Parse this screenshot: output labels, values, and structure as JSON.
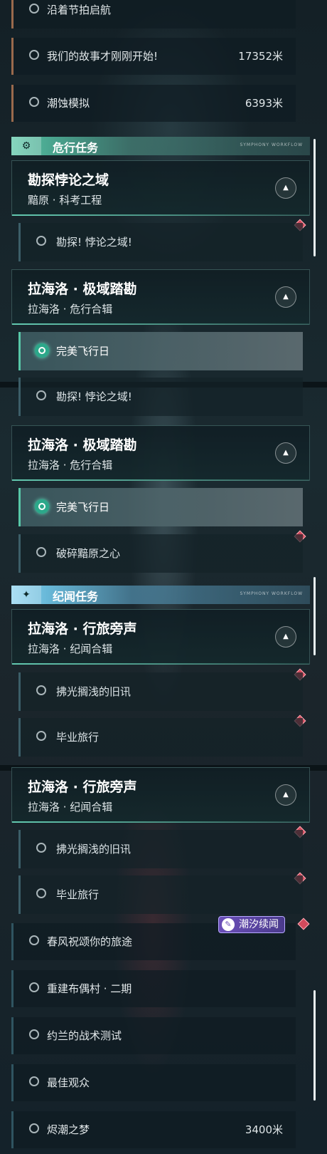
{
  "top_list": [
    {
      "label": "沿着节拍启航",
      "distance": ""
    },
    {
      "label": "我们的故事才刚刚开始!",
      "distance": "17352米"
    },
    {
      "label": "潮蚀模拟",
      "distance": "6393米"
    }
  ],
  "section_danger": {
    "title": "危行任务",
    "tag": "SYMPHONY WORKFLOW",
    "icon": "gear-icon",
    "accent": "#5dc8a8",
    "cards": [
      {
        "title": "勘探悖论之域",
        "subtitle": "黯原 · 科考工程"
      },
      {
        "title": "拉海洛 · 极域踏勘",
        "subtitle": "拉海洛 · 危行合辑"
      }
    ],
    "sub_items": [
      "勘探! 悖论之域!",
      "完美飞行日"
    ]
  },
  "panel2": {
    "sub_top": "勘探! 悖论之域!",
    "card": {
      "title": "拉海洛 · 极域踏勘",
      "subtitle": "拉海洛 · 危行合辑"
    },
    "sub_items": [
      "完美飞行日",
      "破碎黯原之心"
    ]
  },
  "section_story": {
    "title": "纪闻任务",
    "tag": "SYMPHONY WORKFLOW",
    "icon": "sparkle-icon",
    "accent": "#8fd4f0",
    "card": {
      "title": "拉海洛 · 行旅旁声",
      "subtitle": "拉海洛 · 纪闻合辑"
    },
    "sub_items": [
      "拂光搁浅的旧讯",
      "毕业旅行"
    ]
  },
  "panel3": {
    "card": {
      "title": "拉海洛 · 行旅旁声",
      "subtitle": "拉海洛 · 纪闻合辑"
    },
    "sub_items": [
      "拂光搁浅的旧讯",
      "毕业旅行"
    ],
    "badge": "潮汐续闻",
    "list": [
      {
        "label": "春风祝颂你的旅途",
        "distance": ""
      },
      {
        "label": "重建布偶村 · 二期",
        "distance": ""
      },
      {
        "label": "约兰的战术测试",
        "distance": ""
      },
      {
        "label": "最佳观众",
        "distance": ""
      },
      {
        "label": "烬潮之梦",
        "distance": "3400米"
      }
    ]
  },
  "colors": {
    "danger_accent": "#5dc8a8",
    "story_accent": "#8fd4f0",
    "marker": "#d24a5c",
    "badge_bg": "#6b4fb8"
  }
}
